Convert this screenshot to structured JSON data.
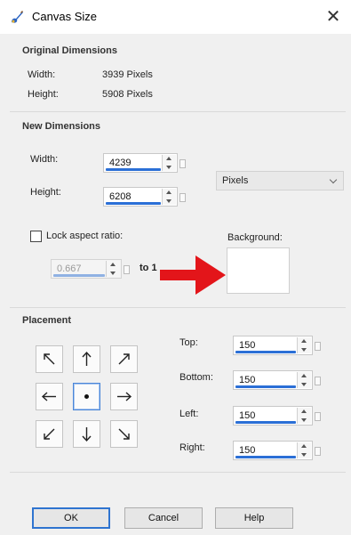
{
  "window": {
    "title": "Canvas Size",
    "close_glyph": "✕",
    "app_icon": "paint-brush-icon"
  },
  "original": {
    "title": "Original Dimensions",
    "width_label": "Width:",
    "width_value": "3939 Pixels",
    "height_label": "Height:",
    "height_value": "5908 Pixels"
  },
  "new_dims": {
    "title": "New Dimensions",
    "width_label": "Width:",
    "width_value": "4239",
    "height_label": "Height:",
    "height_value": "6208",
    "units": "Pixels",
    "lock_label": "Lock aspect ratio:",
    "lock_checked": false,
    "ratio_value": "0.667",
    "ratio_suffix": "to 1",
    "background_label": "Background:",
    "background_color": "#ffffff"
  },
  "placement": {
    "title": "Placement",
    "selected": "center",
    "cells": [
      "top-left",
      "top",
      "top-right",
      "left",
      "center",
      "right",
      "bottom-left",
      "bottom",
      "bottom-right"
    ],
    "top_label": "Top:",
    "top_value": "150",
    "bottom_label": "Bottom:",
    "bottom_value": "150",
    "left_label": "Left:",
    "left_value": "150",
    "right_label": "Right:",
    "right_value": "150"
  },
  "buttons": {
    "ok": "OK",
    "cancel": "Cancel",
    "help": "Help"
  },
  "annotation": {
    "arrow_color": "#e3151a"
  },
  "colors": {
    "accent": "#2b6fd6"
  }
}
